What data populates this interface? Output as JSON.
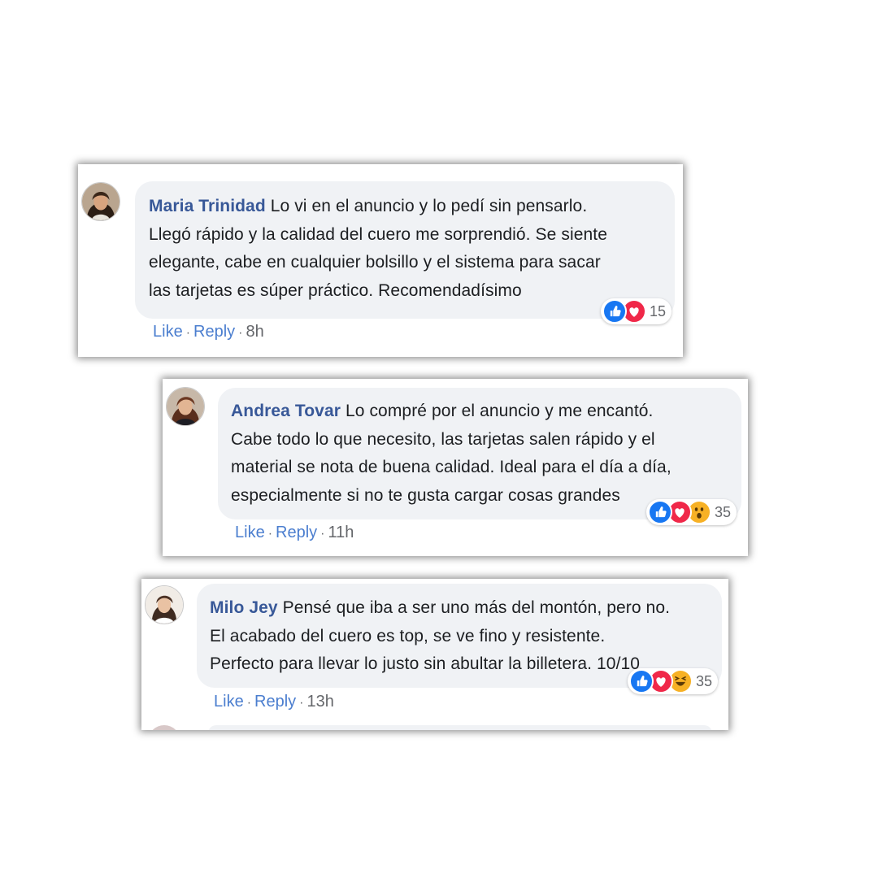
{
  "comments": [
    {
      "name": "Maria Trinidad",
      "line1": "Lo vi en el anuncio y lo pedí sin pensarlo.",
      "line2": "Llegó rápido y la calidad del cuero me sorprendió. Se siente",
      "line3": "elegante, cabe en cualquier bolsillo y el sistema para sacar",
      "line4": "las tarjetas es súper práctico. Recomendadísimo",
      "like_label": "Like",
      "reply_label": "Reply",
      "time": "8h",
      "reaction_count": "15",
      "reactions": [
        "like-icon",
        "love-icon"
      ]
    },
    {
      "name": "Andrea Tovar",
      "line1": "Lo compré por el anuncio y me encantó.",
      "line2": "Cabe todo lo que necesito, las tarjetas salen rápido y el",
      "line3": "material se nota de buena calidad. Ideal para el día a día,",
      "line4": "especialmente si no te gusta cargar cosas grandes",
      "like_label": "Like",
      "reply_label": "Reply",
      "time": "11h",
      "reaction_count": "35",
      "reactions": [
        "like-icon",
        "love-icon",
        "wow-icon"
      ]
    },
    {
      "name": "Milo Jey",
      "line1": "Pensé que iba a ser uno más del montón, pero no.",
      "line2": "El acabado del cuero es top, se ve fino y resistente.",
      "line3": "Perfecto para llevar lo justo sin abultar la billetera. 10/10",
      "like_label": "Like",
      "reply_label": "Reply",
      "time": "13h",
      "reaction_count": "35",
      "reactions": [
        "like-icon",
        "love-icon",
        "haha-icon"
      ]
    }
  ],
  "colors": {
    "name": "#385898",
    "bubble": "#f0f2f5",
    "action_link": "#4b7ecf",
    "like": "#1877f2",
    "love": "#f02849",
    "emoji": "#f7b125"
  }
}
